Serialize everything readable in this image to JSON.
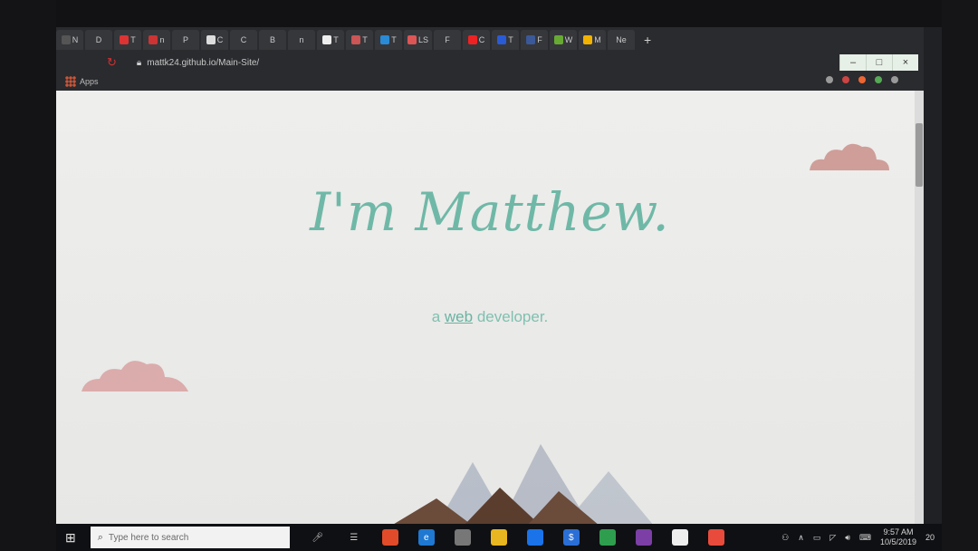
{
  "browser": {
    "url": "mattk24.github.io/Main-Site/",
    "bookmarks_apps_label": "Apps",
    "tabs": [
      "N",
      "D",
      "T",
      "n",
      "P",
      "C",
      "C",
      "B",
      "n",
      "T",
      "T",
      "T",
      "LS",
      "F",
      "C",
      "T",
      "F",
      "W",
      "M",
      "Ne"
    ],
    "new_tab_symbol": "+",
    "window_controls": [
      "–",
      "□",
      "×"
    ]
  },
  "page": {
    "title": "I'm Matthew.",
    "subtitle_prefix": "a",
    "subtitle_link": "web",
    "subtitle_suffix": "developer."
  },
  "taskbar": {
    "search_placeholder": "Type here to search",
    "time": "9:57 AM",
    "date": "10/5/2019",
    "notification_count": "20"
  },
  "colors": {
    "accent": "#6fb8a7",
    "cloud": "#c98f8b",
    "chrome_bg": "#2a2b2e"
  },
  "icons": {
    "start": "windows-start-icon",
    "search": "search-icon",
    "lock": "lock-icon"
  }
}
